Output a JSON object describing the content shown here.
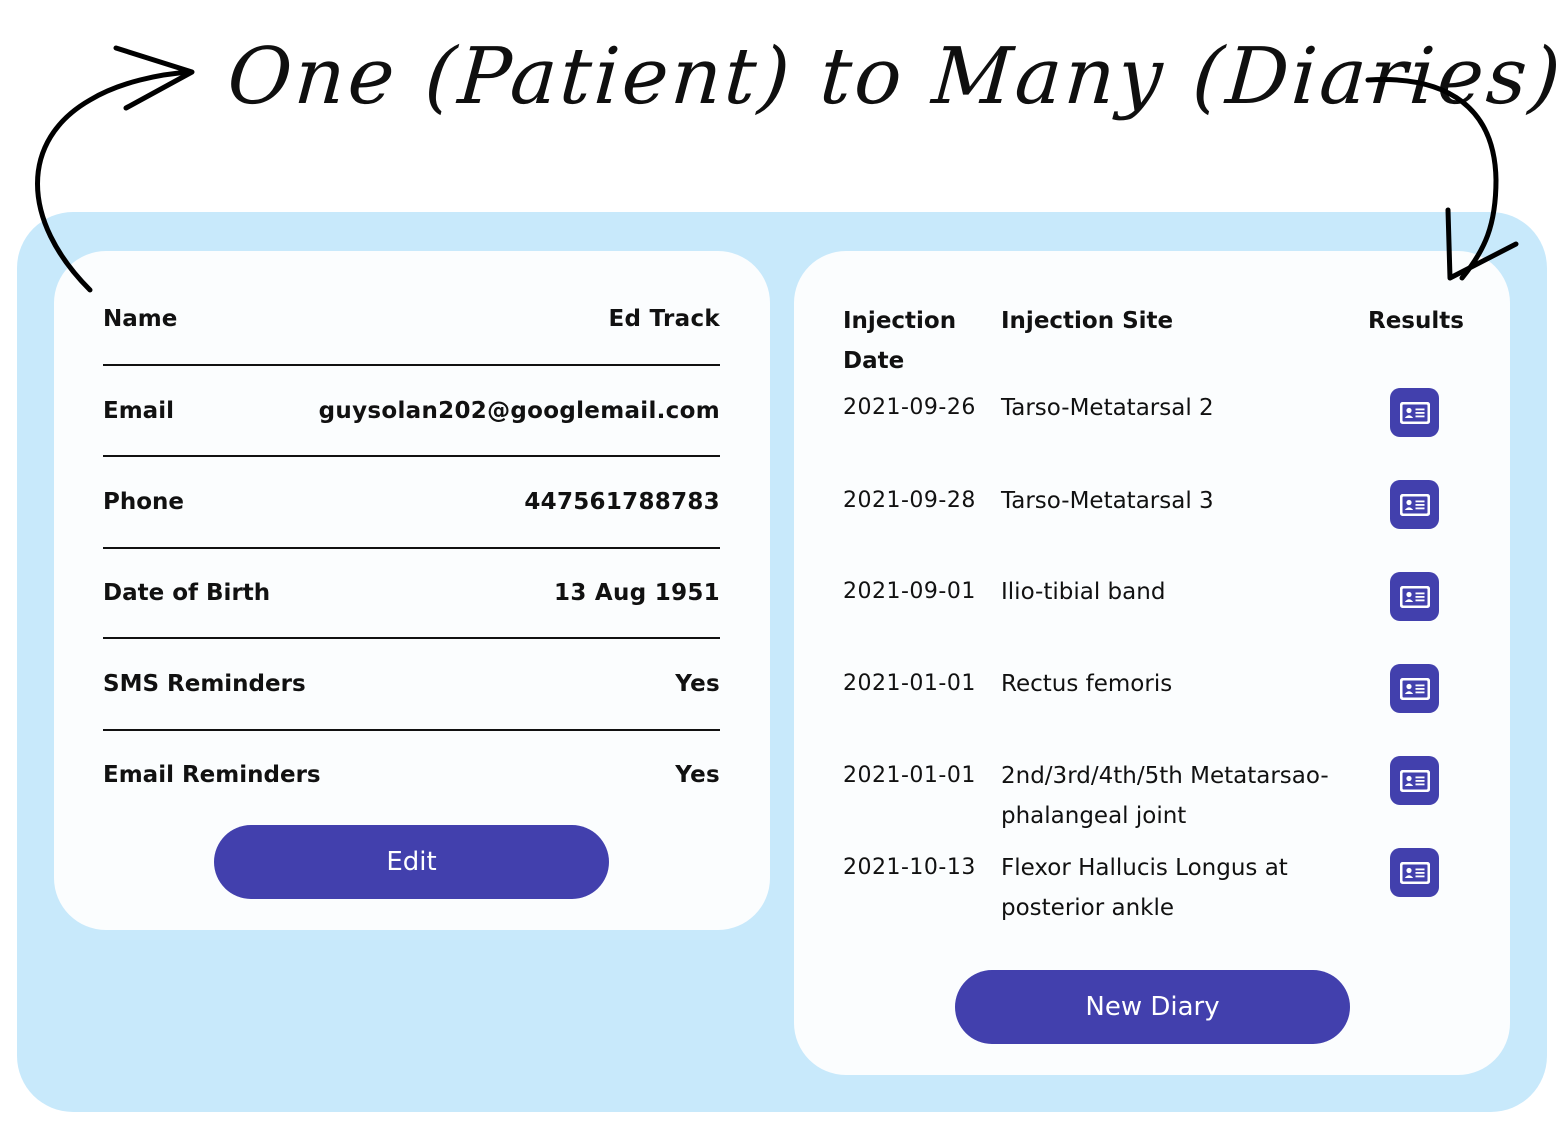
{
  "headline": "One (Patient) to Many (Diaries)",
  "colors": {
    "backdrop": "#c8e9fb",
    "card": "#fbfdfe",
    "accent": "#4240ad",
    "text": "#111111"
  },
  "patient": {
    "fields": [
      {
        "label": "Name",
        "value": "Ed Track"
      },
      {
        "label": "Email",
        "value": "guysolan202@googlemail.com"
      },
      {
        "label": "Phone",
        "value": "447561788783"
      },
      {
        "label": "Date of Birth",
        "value": "13 Aug 1951"
      },
      {
        "label": "SMS Reminders",
        "value": "Yes"
      },
      {
        "label": "Email Reminders",
        "value": "Yes"
      }
    ],
    "edit_label": "Edit"
  },
  "diaries": {
    "headers": {
      "date": "Injection Date",
      "site": "Injection Site",
      "results": "Results"
    },
    "rows": [
      {
        "date": "2021-09-26",
        "site": "Tarso-Metatarsal 2",
        "results_icon": "id-card-icon"
      },
      {
        "date": "2021-09-28",
        "site": "Tarso-Metatarsal 3",
        "results_icon": "id-card-icon"
      },
      {
        "date": "2021-09-01",
        "site": "Ilio-tibial band",
        "results_icon": "id-card-icon"
      },
      {
        "date": "2021-01-01",
        "site": "Rectus femoris",
        "results_icon": "id-card-icon"
      },
      {
        "date": "2021-01-01",
        "site": "2nd/3rd/4th/5th Metatarsao-phalangeal joint",
        "results_icon": "id-card-icon"
      },
      {
        "date": "2021-10-13",
        "site": "Flexor Hallucis Longus at posterior ankle",
        "results_icon": "id-card-icon"
      }
    ],
    "new_label": "New Diary"
  }
}
